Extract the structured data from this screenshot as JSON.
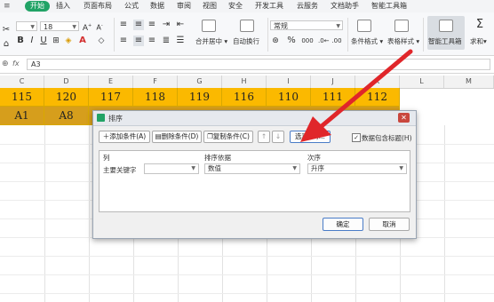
{
  "ribbon": {
    "tabs": [
      "开始",
      "插入",
      "页面布局",
      "公式",
      "数据",
      "审阅",
      "视图",
      "安全",
      "开发工具",
      "云服务",
      "文档助手",
      "智能工具箱"
    ],
    "active_tab": "开始"
  },
  "toolbar": {
    "font_size": "18",
    "number_format": "常规",
    "merge_label": "合并居中",
    "wrap_label": "自动换行",
    "cond_format_label": "条件格式",
    "table_style_label": "表格样式",
    "smart_toolbox_label": "智能工具箱",
    "sum_label": "求和",
    "bold": "B",
    "italic": "I",
    "underline": "U",
    "font_color_letter": "A",
    "percent": "%",
    "thousands": "000"
  },
  "formula_bar": {
    "fx": "fx",
    "value": "A3"
  },
  "columns": [
    "C",
    "D",
    "E",
    "F",
    "G",
    "H",
    "I",
    "J",
    "K",
    "L",
    "M"
  ],
  "rows": {
    "row1": [
      "115",
      "120",
      "117",
      "118",
      "119",
      "116",
      "110",
      "111",
      "112"
    ],
    "row2": [
      "A1",
      "A8"
    ]
  },
  "dialog": {
    "title": "排序",
    "add_condition": "添加条件(A)",
    "delete_condition": "删除条件(D)",
    "copy_condition": "复制条件(C)",
    "up": "↑",
    "down": "↓",
    "options": "选项(O)...",
    "header_checkbox_label": "数据包含标题(H)",
    "header_checked": true,
    "col_header": "列",
    "sort_on_header": "排序依据",
    "order_header": "次序",
    "primary_key_label": "主要关键字",
    "primary_key_value": "",
    "sort_on_value": "数值",
    "order_value": "升序",
    "ok": "确定",
    "cancel": "取消"
  },
  "colors": {
    "accent_green": "#21a366",
    "row1_fill": "#fbb900",
    "row2_fill": "#d69e1c",
    "arrow_red": "#e0262a"
  }
}
